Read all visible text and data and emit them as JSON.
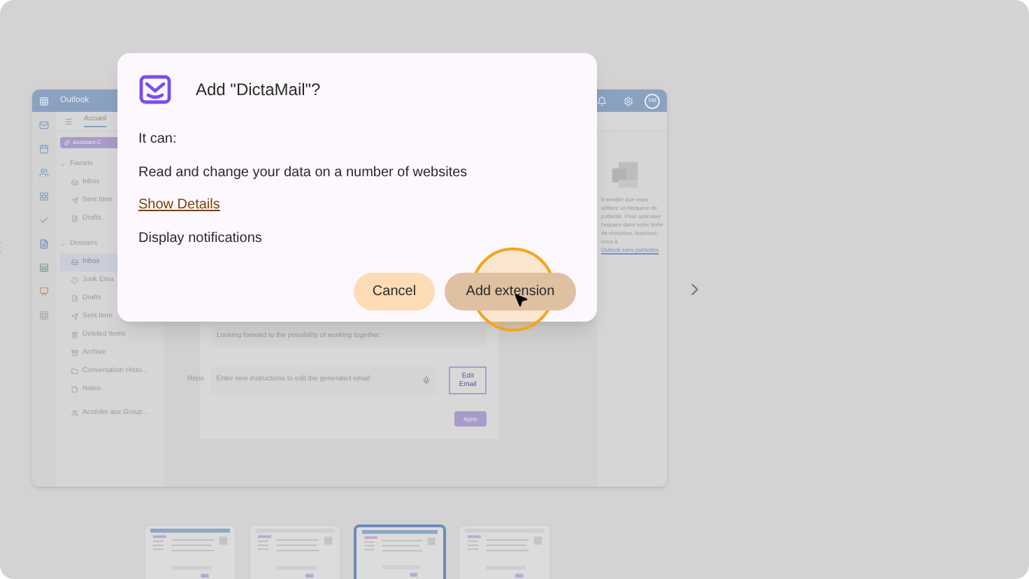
{
  "outlook": {
    "app_name": "Outlook",
    "avatar": "SM",
    "ribbon_tab": "Accueil",
    "assistant_button": "Assistant C",
    "folder_groups": [
      {
        "label": "Favoris",
        "items": [
          {
            "label": "Inbox",
            "selected": false
          },
          {
            "label": "Sent Item",
            "selected": false
          },
          {
            "label": "Drafts",
            "selected": false
          }
        ]
      },
      {
        "label": "Dossiers",
        "items": [
          {
            "label": "Inbox",
            "selected": true
          },
          {
            "label": "Junk Ema",
            "selected": false
          },
          {
            "label": "Drafts",
            "selected": false
          },
          {
            "label": "Sent Item",
            "selected": false
          },
          {
            "label": "Deleted Items",
            "selected": false
          },
          {
            "label": "Archive",
            "selected": false
          },
          {
            "label": "Conversation Histo...",
            "selected": false
          },
          {
            "label": "Notes",
            "selected": false
          }
        ]
      }
    ],
    "groups_link": "Accéder aux Group...",
    "quoted_text": "Looking forward to the possibility of working together.",
    "reply_label": "Répo",
    "instructions_placeholder": "Enter new instructions to edit the generated email",
    "edit_button": "Edit Email",
    "apply_button": "Apply",
    "ad_notice": "Il semble que vous utilisez un bloqueur de publicité. Pour optimiser l'espace dans votre boîte de réception, inscrivez-vous à",
    "ad_link": "Outlook sans publicités"
  },
  "dialog": {
    "title": "Add \"DictaMail\"?",
    "intro": "It can:",
    "permissions": [
      "Read and change your data on a number of websites",
      "Display notifications"
    ],
    "details_link": "Show Details",
    "cancel_button": "Cancel",
    "confirm_button": "Add extension"
  },
  "thumbnails": [
    {
      "selected": false
    },
    {
      "selected": false
    },
    {
      "selected": true
    },
    {
      "selected": false
    }
  ]
}
